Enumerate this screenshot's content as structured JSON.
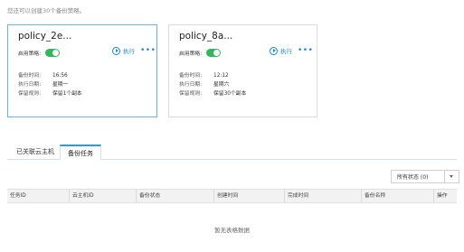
{
  "hint": "您还可以创建30个备份策略。",
  "cards": [
    {
      "title": "policy_2e...",
      "enable_label": "启用策略:",
      "exec_label": "执行",
      "more": "•••",
      "rows": [
        {
          "key": "备份时间:",
          "val": "16:56"
        },
        {
          "key": "执行日期:",
          "val": "星期一"
        },
        {
          "key": "保留规则:",
          "val": "保留1个副本"
        }
      ]
    },
    {
      "title": "policy_8a...",
      "enable_label": "启用策略:",
      "exec_label": "执行",
      "more": "•••",
      "rows": [
        {
          "key": "备份时间:",
          "val": "12:12"
        },
        {
          "key": "执行日期:",
          "val": "星期六"
        },
        {
          "key": "保留规则:",
          "val": "保留30个副本"
        }
      ]
    }
  ],
  "tabs": [
    {
      "label": "已关联云主机"
    },
    {
      "label": "备份任务"
    }
  ],
  "status_filter": {
    "selected": "所有状态 (0)"
  },
  "table": {
    "columns": [
      "任务ID",
      "云主机ID",
      "备份状态",
      "创建时间",
      "完成时间",
      "备份名称",
      "操作"
    ],
    "empty_text": "暂无表格数据"
  },
  "colors": {
    "accent": "#1a8ad4",
    "toggle_on": "#33b75a",
    "selected_border": "#6cb3d6"
  }
}
